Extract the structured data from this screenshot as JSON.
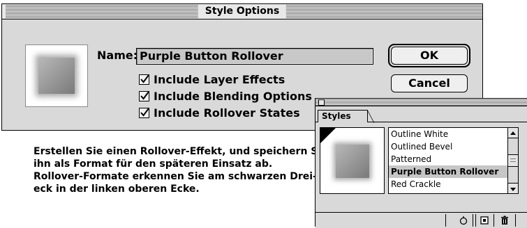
{
  "dialog": {
    "title": "Style Options",
    "name_label": "Name:",
    "name_value": "Purple Button Rollover",
    "checkboxes": [
      {
        "label": "Include Layer Effects",
        "checked": true
      },
      {
        "label": "Include Blending Options",
        "checked": true
      },
      {
        "label": "Include Rollover States",
        "checked": true
      }
    ],
    "ok_label": "OK",
    "cancel_label": "Cancel"
  },
  "caption": {
    "lines": [
      "Erstellen Sie einen Rollover-Effekt, und speichern Sie",
      "ihn als Format für den späteren Einsatz ab.",
      "Rollover-Formate erkennen Sie am schwarzen Drei-",
      "eck in der linken oberen Ecke."
    ]
  },
  "palette": {
    "tab_label": "Styles",
    "items": [
      "Outline White",
      "Outlined Bevel",
      "Patterned",
      "Purple Button Rollover",
      "Red Crackle"
    ],
    "selected_item": "Purple Button Rollover",
    "footer_icons": [
      "clear-style-icon",
      "new-style-icon",
      "trash-icon"
    ]
  }
}
